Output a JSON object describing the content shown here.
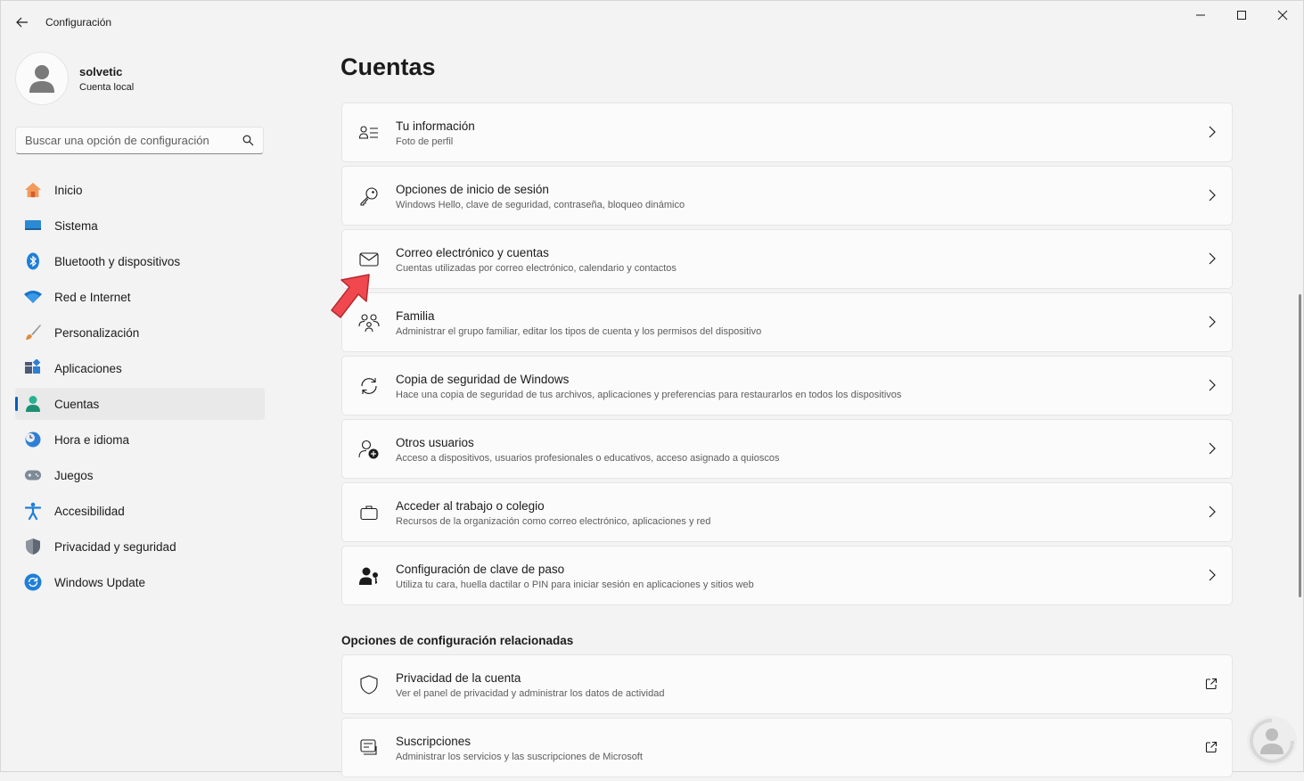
{
  "window": {
    "title": "Configuración",
    "back_icon": "back-arrow-icon",
    "controls": [
      "minimize-icon",
      "maximize-icon",
      "close-icon"
    ]
  },
  "profile": {
    "name": "solvetic",
    "account_type": "Cuenta local"
  },
  "search": {
    "placeholder": "Buscar una opción de configuración"
  },
  "nav": {
    "selected": "Cuentas",
    "items": [
      {
        "label": "Inicio",
        "icon": "home-icon"
      },
      {
        "label": "Sistema",
        "icon": "system-icon"
      },
      {
        "label": "Bluetooth y dispositivos",
        "icon": "bluetooth-icon"
      },
      {
        "label": "Red e Internet",
        "icon": "wifi-icon"
      },
      {
        "label": "Personalización",
        "icon": "brush-icon"
      },
      {
        "label": "Aplicaciones",
        "icon": "apps-icon"
      },
      {
        "label": "Cuentas",
        "icon": "account-icon"
      },
      {
        "label": "Hora e idioma",
        "icon": "clock-globe-icon"
      },
      {
        "label": "Juegos",
        "icon": "gamepad-icon"
      },
      {
        "label": "Accesibilidad",
        "icon": "accessibility-icon"
      },
      {
        "label": "Privacidad y seguridad",
        "icon": "shield-icon"
      },
      {
        "label": "Windows Update",
        "icon": "update-icon"
      }
    ]
  },
  "main": {
    "title": "Cuentas",
    "cards": [
      {
        "title": "Tu información",
        "subtitle": "Foto de perfil",
        "icon": "person-info-icon"
      },
      {
        "title": "Opciones de inicio de sesión",
        "subtitle": "Windows Hello, clave de seguridad, contraseña, bloqueo dinámico",
        "icon": "key-icon"
      },
      {
        "title": "Correo electrónico y cuentas",
        "subtitle": "Cuentas utilizadas por correo electrónico, calendario y contactos",
        "icon": "mail-icon"
      },
      {
        "title": "Familia",
        "subtitle": "Administrar el grupo familiar, editar los tipos de cuenta y los permisos del dispositivo",
        "icon": "family-icon"
      },
      {
        "title": "Copia de seguridad de Windows",
        "subtitle": "Hace una copia de seguridad de tus archivos, aplicaciones y preferencias para restaurarlos en todos los dispositivos",
        "icon": "sync-icon"
      },
      {
        "title": "Otros usuarios",
        "subtitle": "Acceso a dispositivos, usuarios profesionales o educativos, acceso asignado a quioscos",
        "icon": "add-user-icon"
      },
      {
        "title": "Acceder al trabajo o colegio",
        "subtitle": "Recursos de la organización como correo electrónico, aplicaciones y red",
        "icon": "briefcase-icon"
      },
      {
        "title": "Configuración de clave de paso",
        "subtitle": "Utiliza tu cara, huella dactilar o PIN para iniciar sesión en aplicaciones y sitios web",
        "icon": "passkey-icon"
      }
    ],
    "related_heading": "Opciones de configuración relacionadas",
    "related": [
      {
        "title": "Privacidad de la cuenta",
        "subtitle": "Ver el panel de privacidad y administrar los datos de actividad",
        "icon": "shield-outline-icon"
      },
      {
        "title": "Suscripciones",
        "subtitle": "Administrar los servicios y las suscripciones de Microsoft",
        "icon": "subscription-icon"
      }
    ]
  },
  "colors": {
    "accent": "#005fb8",
    "annotation_arrow": "#f0484e"
  }
}
